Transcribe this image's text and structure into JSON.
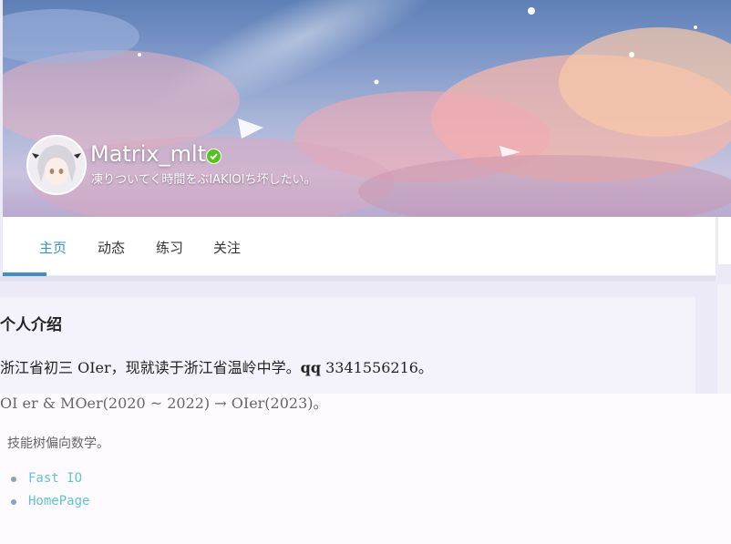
{
  "profile": {
    "username": "Matrix_mlt",
    "motto": "凍りついてく時間をぶIAKIOIち坏したい。"
  },
  "tabs": [
    "主页",
    "动态",
    "练习",
    "关注"
  ],
  "intro": {
    "title": "个人介绍",
    "line1_text": "浙江省初三 OIer，现就读于浙江省温岭中学。",
    "line1_bold": "qq",
    "line1_number": "3341556216。",
    "line2": "OI er & MOer(2020 ~ 2022) → OIer(2023)。",
    "line3": "技能树偏向数学。",
    "links": [
      "Fast IO",
      "HomePage"
    ]
  },
  "colors": {
    "accent": "#3a8fd1",
    "link": "#5fc3d6",
    "verified": "#52c41a"
  },
  "icons": {
    "verified": "check-badge-icon"
  }
}
